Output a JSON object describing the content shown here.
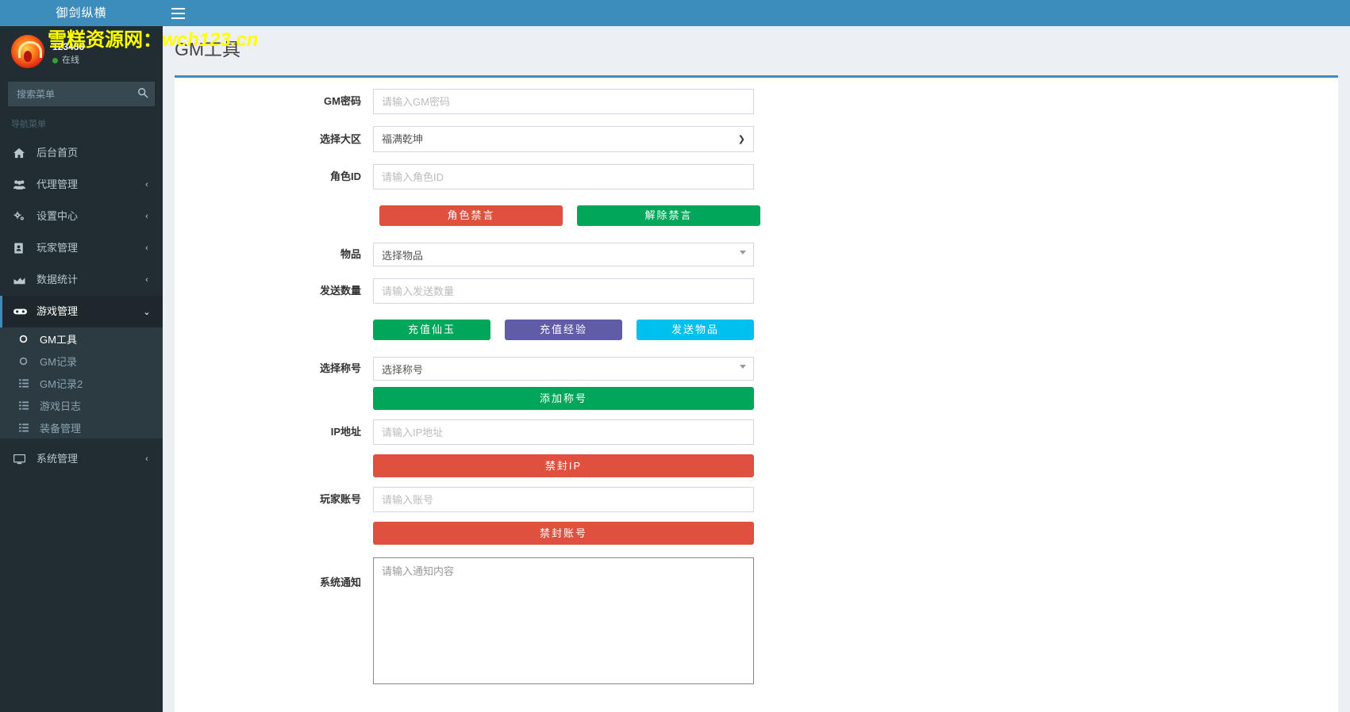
{
  "brand": {
    "title": "御剑纵横"
  },
  "watermark": {
    "text_cn": "雪糕资源网：",
    "text_en": "wch123.cn"
  },
  "user": {
    "name": "123456",
    "status": "在线"
  },
  "search": {
    "placeholder": "搜索菜单",
    "icon": "search-icon"
  },
  "sidebar": {
    "section_label": "导航菜单",
    "items": [
      {
        "label": "后台首页",
        "icon": "home-icon",
        "arrow": "",
        "state": "normal"
      },
      {
        "label": "代理管理",
        "icon": "users-icon",
        "arrow": "‹",
        "state": "normal"
      },
      {
        "label": "设置中心",
        "icon": "cogs-icon",
        "arrow": "‹",
        "state": "normal"
      },
      {
        "label": "玩家管理",
        "icon": "address-book-icon",
        "arrow": "‹",
        "state": "normal"
      },
      {
        "label": "数据统计",
        "icon": "chart-area-icon",
        "arrow": "‹",
        "state": "normal"
      },
      {
        "label": "游戏管理",
        "icon": "gamepad-icon",
        "arrow": "⌄",
        "state": "open"
      },
      {
        "label": "系统管理",
        "icon": "desktop-icon",
        "arrow": "‹",
        "state": "normal"
      }
    ],
    "submenu": [
      {
        "label": "GM工具",
        "icon": "circle-o-icon",
        "active": true
      },
      {
        "label": "GM记录",
        "icon": "circle-o-icon",
        "active": false
      },
      {
        "label": "GM记录2",
        "icon": "list-icon",
        "active": false
      },
      {
        "label": "游戏日志",
        "icon": "list-icon",
        "active": false
      },
      {
        "label": "装备管理",
        "icon": "list-icon",
        "active": false
      }
    ]
  },
  "topbar": {
    "menu_toggle": "hamburger-icon"
  },
  "page": {
    "title": "GM工具"
  },
  "form": {
    "gm_password": {
      "label": "GM密码",
      "placeholder": "请输入GM密码",
      "value": ""
    },
    "region": {
      "label": "选择大区",
      "selected": "福满乾坤",
      "options": [
        "福满乾坤"
      ]
    },
    "role_id": {
      "label": "角色ID",
      "placeholder": "请输入角色ID",
      "value": ""
    },
    "mute_button": "角色禁言",
    "unmute_button": "解除禁言",
    "item": {
      "label": "物品",
      "selected": "选择物品",
      "options": [
        "选择物品"
      ]
    },
    "send_count": {
      "label": "发送数量",
      "placeholder": "请输入发送数量",
      "value": ""
    },
    "recharge_jade_button": "充值仙玉",
    "recharge_exp_button": "充值经验",
    "send_item_button": "发送物品",
    "title_select": {
      "label": "选择称号",
      "selected": "选择称号",
      "options": [
        "选择称号"
      ]
    },
    "add_title_button": "添加称号",
    "ip_address": {
      "label": "IP地址",
      "placeholder": "请输入IP地址",
      "value": ""
    },
    "ban_ip_button": "禁封IP",
    "player_account": {
      "label": "玩家账号",
      "placeholder": "请输入账号",
      "value": ""
    },
    "ban_account_button": "禁封账号",
    "system_notice": {
      "label": "系统通知",
      "placeholder": "请输入通知内容",
      "value": ""
    }
  },
  "colors": {
    "header_blue": "#3c8dbc",
    "sidebar_dark": "#222d32",
    "danger_red": "#e0503e",
    "success_green": "#00a65a",
    "purple": "#605ca8",
    "cyan": "#00c0ef",
    "watermark_yellow": "#ffff00"
  }
}
